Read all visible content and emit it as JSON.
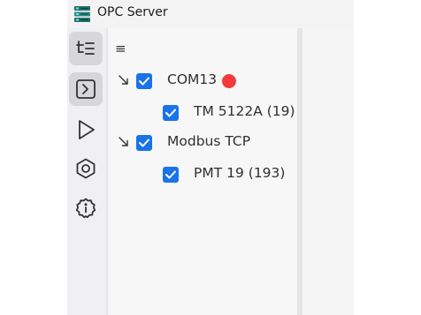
{
  "window": {
    "title": "OPC Server",
    "icon": "server-rack-icon"
  },
  "activity_bar": {
    "items": [
      {
        "name": "tree-view",
        "icon": "tree-list-icon",
        "active": true
      },
      {
        "name": "console",
        "icon": "terminal-icon",
        "active": true
      },
      {
        "name": "run",
        "icon": "play-icon",
        "active": false
      },
      {
        "name": "settings",
        "icon": "hexagon-gear-icon",
        "active": false
      },
      {
        "name": "info",
        "icon": "info-badge-icon",
        "active": false
      }
    ]
  },
  "tree": {
    "menu_icon": "≡",
    "nodes": [
      {
        "label": "COM13",
        "checked": true,
        "expanded": true,
        "status_color": "#f23c3c",
        "children": [
          {
            "label": "TM 5122A (19)",
            "checked": true
          }
        ]
      },
      {
        "label": "Modbus TCP",
        "checked": true,
        "expanded": true,
        "children": [
          {
            "label": "PMT 19 (193)",
            "checked": true
          }
        ]
      }
    ]
  },
  "colors": {
    "accent": "#1a73e8",
    "error": "#f23c3c",
    "active_button": "#d7d7d9"
  }
}
